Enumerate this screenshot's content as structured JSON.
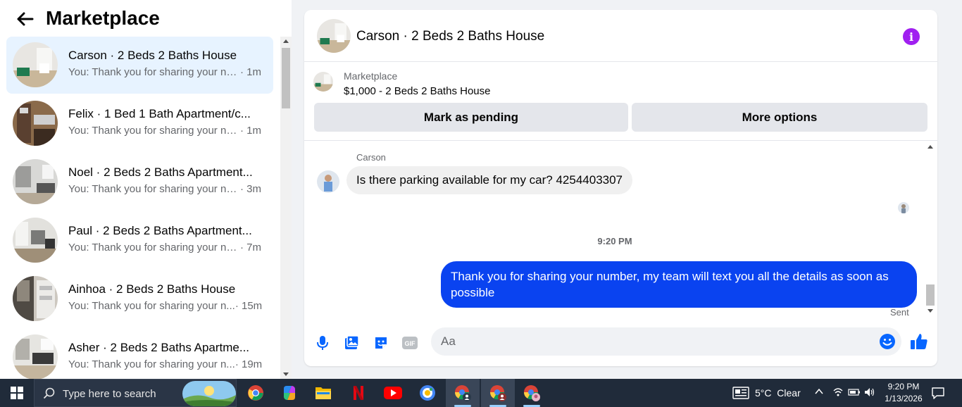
{
  "left_panel": {
    "title": "Marketplace",
    "conversations": [
      {
        "name": "Carson · 2 Beds 2 Baths House",
        "preview": "You: Thank you for sharing your nu...",
        "time": "· 1m",
        "active": true
      },
      {
        "name": "Felix · 1 Bed 1 Bath Apartment/c...",
        "preview": "You: Thank you for sharing your nu...",
        "time": "· 1m",
        "active": false
      },
      {
        "name": "Noel · 2 Beds 2 Baths Apartment...",
        "preview": "You: Thank you for sharing your nu...",
        "time": "· 3m",
        "active": false
      },
      {
        "name": "Paul · 2 Beds 2 Baths Apartment...",
        "preview": "You: Thank you for sharing your nu...",
        "time": "· 7m",
        "active": false
      },
      {
        "name": "Ainhoa · 2 Beds 2 Baths House",
        "preview": "You: Thank you for sharing your n...",
        "time": "· 15m",
        "active": false
      },
      {
        "name": "Asher · 2 Beds 2 Baths Apartme...",
        "preview": "You: Thank you for sharing your n...",
        "time": "· 19m",
        "active": false
      }
    ]
  },
  "chat": {
    "title": "Carson · 2 Beds 2 Baths House",
    "listing_label": "Marketplace",
    "listing_desc": "$1,000 - 2 Beds 2 Baths House",
    "mark_pending_label": "Mark as pending",
    "more_options_label": "More options",
    "sender_name": "Carson",
    "incoming_message": "Is there parking available for my car? 4254403307",
    "timestamp": "9:20 PM",
    "outgoing_message": "Thank you for  sharing your number, my team will text you all the details as soon as possible",
    "sent_label": "Sent",
    "input_placeholder": "Aa",
    "accent_color": "#0a43f0",
    "icons": [
      "microphone-icon",
      "image-icon",
      "sticker-icon",
      "gif-icon",
      "emoji-icon",
      "thumbs-up-icon"
    ]
  },
  "taskbar": {
    "search_placeholder": "Type here to search",
    "weather": "5°C  Clear",
    "time": "9:20 PM",
    "date": "1/13/2026",
    "apps": [
      "chrome-icon",
      "copilot-icon",
      "file-explorer-icon",
      "netflix-icon",
      "youtube-icon",
      "google-lens-icon",
      "chrome-profile-1-icon",
      "chrome-profile-2-icon",
      "chrome-profile-3-icon"
    ]
  }
}
